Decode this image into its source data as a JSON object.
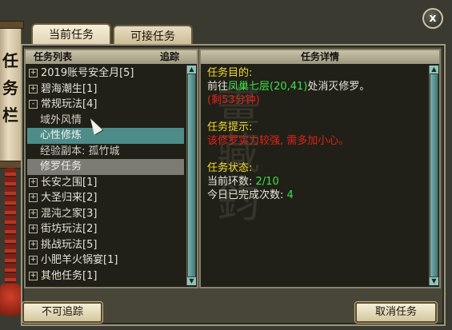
{
  "tabs": [
    {
      "label": "当前任务",
      "active": true
    },
    {
      "label": "可接任务",
      "active": false
    }
  ],
  "scroll_text": "任务栏",
  "close_label": "x",
  "list_header": {
    "title": "任务列表",
    "track": "追踪"
  },
  "detail_header": "任务详情",
  "quest_list": [
    {
      "label": "2019账号安全月[5]",
      "type": "group",
      "expander": "+"
    },
    {
      "label": "碧海潮生[1]",
      "type": "group",
      "expander": "+"
    },
    {
      "label": "常规玩法[4]",
      "type": "group",
      "expander": "-"
    },
    {
      "label": "域外风情",
      "type": "sub",
      "state": "normal"
    },
    {
      "label": "心性修炼",
      "type": "sub",
      "state": "selected"
    },
    {
      "label": "经验副本: 孤竹城",
      "type": "sub",
      "state": "normal"
    },
    {
      "label": "修罗任务",
      "type": "sub",
      "state": "grey"
    },
    {
      "label": "长安之围[1]",
      "type": "group",
      "expander": "+"
    },
    {
      "label": "大圣归来[2]",
      "type": "group",
      "expander": "+"
    },
    {
      "label": "混沌之家[3]",
      "type": "group",
      "expander": "+"
    },
    {
      "label": "街坊玩法[2]",
      "type": "group",
      "expander": "+"
    },
    {
      "label": "挑战玩法[5]",
      "type": "group",
      "expander": "+"
    },
    {
      "label": "小肥羊火锅宴[1]",
      "type": "group",
      "expander": "+"
    },
    {
      "label": "其他任务[1]",
      "type": "group",
      "expander": "+"
    }
  ],
  "details": {
    "goal_heading": "任务目的:",
    "goal_prefix": "前往",
    "goal_place": "凤巢七层(20,41)",
    "goal_suffix": "处消灭修罗。",
    "goal_time": "(剩53分钟)",
    "hint_heading": "任务提示:",
    "hint_text": "该修罗实力较强, 需多加小心。",
    "status_heading": "任务状态:",
    "rounds_label": "当前环数: ",
    "rounds_value": "2/10",
    "done_label": "今日已完成次数: ",
    "done_value": "4"
  },
  "buttons": {
    "untrack": "不可追踪",
    "cancel": "取消任务"
  },
  "colors": {
    "heading": "#f2dc2e",
    "warning": "#e0231a",
    "place": "#3fe04a",
    "selected_row": "#4e8c8a"
  }
}
